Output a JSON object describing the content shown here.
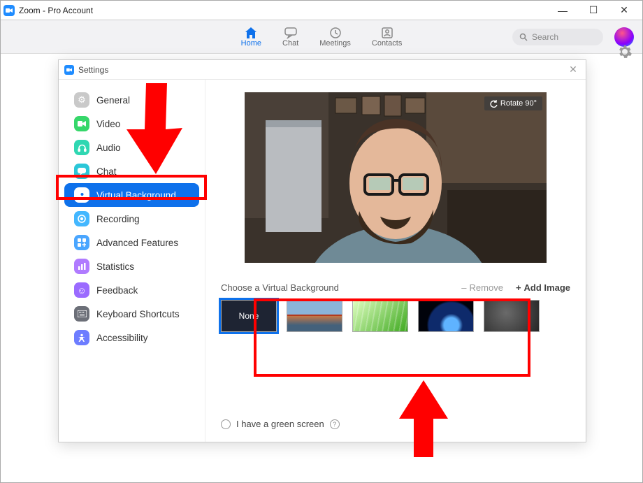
{
  "window": {
    "title": "Zoom - Pro Account"
  },
  "nav": {
    "items": [
      {
        "id": "home",
        "label": "Home",
        "active": true
      },
      {
        "id": "chat",
        "label": "Chat",
        "active": false
      },
      {
        "id": "meetings",
        "label": "Meetings",
        "active": false
      },
      {
        "id": "contacts",
        "label": "Contacts",
        "active": false
      }
    ],
    "search_placeholder": "Search"
  },
  "settings": {
    "title": "Settings",
    "sidebar": [
      {
        "id": "general",
        "label": "General",
        "icon": "gear",
        "color": "#c9c9c9"
      },
      {
        "id": "video",
        "label": "Video",
        "icon": "video",
        "color": "#36d76a"
      },
      {
        "id": "audio",
        "label": "Audio",
        "icon": "headphones",
        "color": "#2fd7b2"
      },
      {
        "id": "chat",
        "label": "Chat",
        "icon": "chat",
        "color": "#2bc7d8"
      },
      {
        "id": "virtual-background",
        "label": "Virtual Background",
        "icon": "user-card",
        "color": "#0e71eb",
        "active": true
      },
      {
        "id": "recording",
        "label": "Recording",
        "icon": "record",
        "color": "#43b7ff"
      },
      {
        "id": "advanced",
        "label": "Advanced Features",
        "icon": "plus",
        "color": "#4aa6ff"
      },
      {
        "id": "statistics",
        "label": "Statistics",
        "icon": "bars",
        "color": "#b07bff"
      },
      {
        "id": "feedback",
        "label": "Feedback",
        "icon": "smile",
        "color": "#9b6bff"
      },
      {
        "id": "shortcuts",
        "label": "Keyboard Shortcuts",
        "icon": "keyboard",
        "color": "#6c6f78"
      },
      {
        "id": "accessibility",
        "label": "Accessibility",
        "icon": "person",
        "color": "#6d7dff"
      }
    ],
    "rotate_label": "Rotate 90°",
    "choose_label": "Choose a Virtual Background",
    "remove_label": "Remove",
    "add_label": "Add Image",
    "backgrounds": [
      {
        "id": "none",
        "label": "None",
        "selected": true
      },
      {
        "id": "bridge",
        "label": "Golden Gate"
      },
      {
        "id": "grass",
        "label": "Grass"
      },
      {
        "id": "earth",
        "label": "Earth"
      },
      {
        "id": "blur",
        "label": "Blur"
      }
    ],
    "green_screen_label": "I have a green screen"
  }
}
